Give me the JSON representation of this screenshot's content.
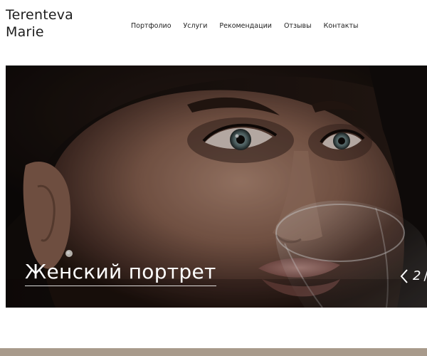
{
  "header": {
    "logo_line1": "Terenteva",
    "logo_line2": "Marie",
    "nav": [
      {
        "label": "Портфолио"
      },
      {
        "label": "Услуги"
      },
      {
        "label": "Рекомендации"
      },
      {
        "label": "Отзывы"
      },
      {
        "label": "Контакты"
      }
    ]
  },
  "hero": {
    "slide_title": "Женский портрет",
    "slide_number": "2",
    "slide_separator": "/",
    "image_subject": "close-up portrait of a woman drinking from a wine glass"
  },
  "colors": {
    "footer_strip": "#a89a8b",
    "text": "#222222",
    "hero_overlay_text": "#ffffff"
  }
}
